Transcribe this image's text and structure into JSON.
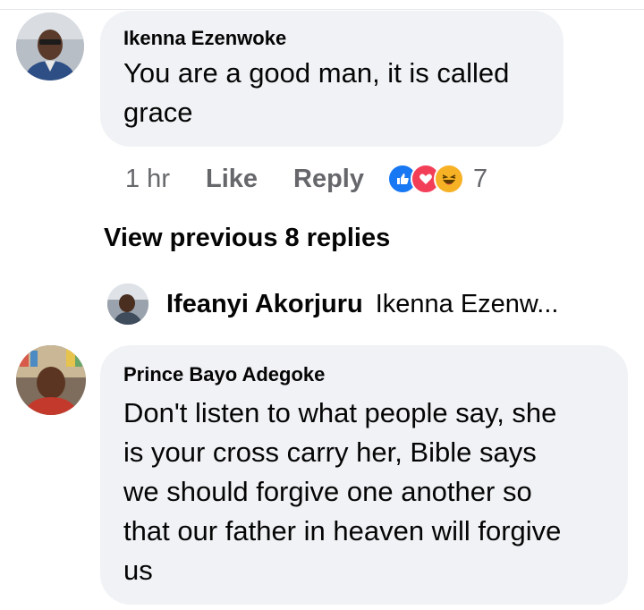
{
  "comment1": {
    "author": "Ikenna Ezenwoke",
    "text_line1": "You are a good man, it is called",
    "text_line2": "grace",
    "time": "1 hr",
    "like_label": "Like",
    "reply_label": "Reply",
    "reactions": [
      "like-icon",
      "love-icon",
      "haha-icon"
    ],
    "reaction_count": "7"
  },
  "view_previous_replies": "View previous 8 replies",
  "reply_preview": {
    "author": "Ifeanyi Akorjuru",
    "snippet": "Ikenna Ezenw..."
  },
  "comment2": {
    "author": "Prince Bayo Adegoke",
    "lines": [
      "Don't listen to what people say, she",
      "is your cross carry her, Bible says",
      "we should forgive one another so",
      "that our father in heaven will forgive",
      "us"
    ]
  },
  "colors": {
    "bubble": "#f0f2f5",
    "secondary_text": "#65676b",
    "like_blue": "#1877f2",
    "love_red": "#f33e58",
    "haha_yellow": "#f7b125"
  }
}
